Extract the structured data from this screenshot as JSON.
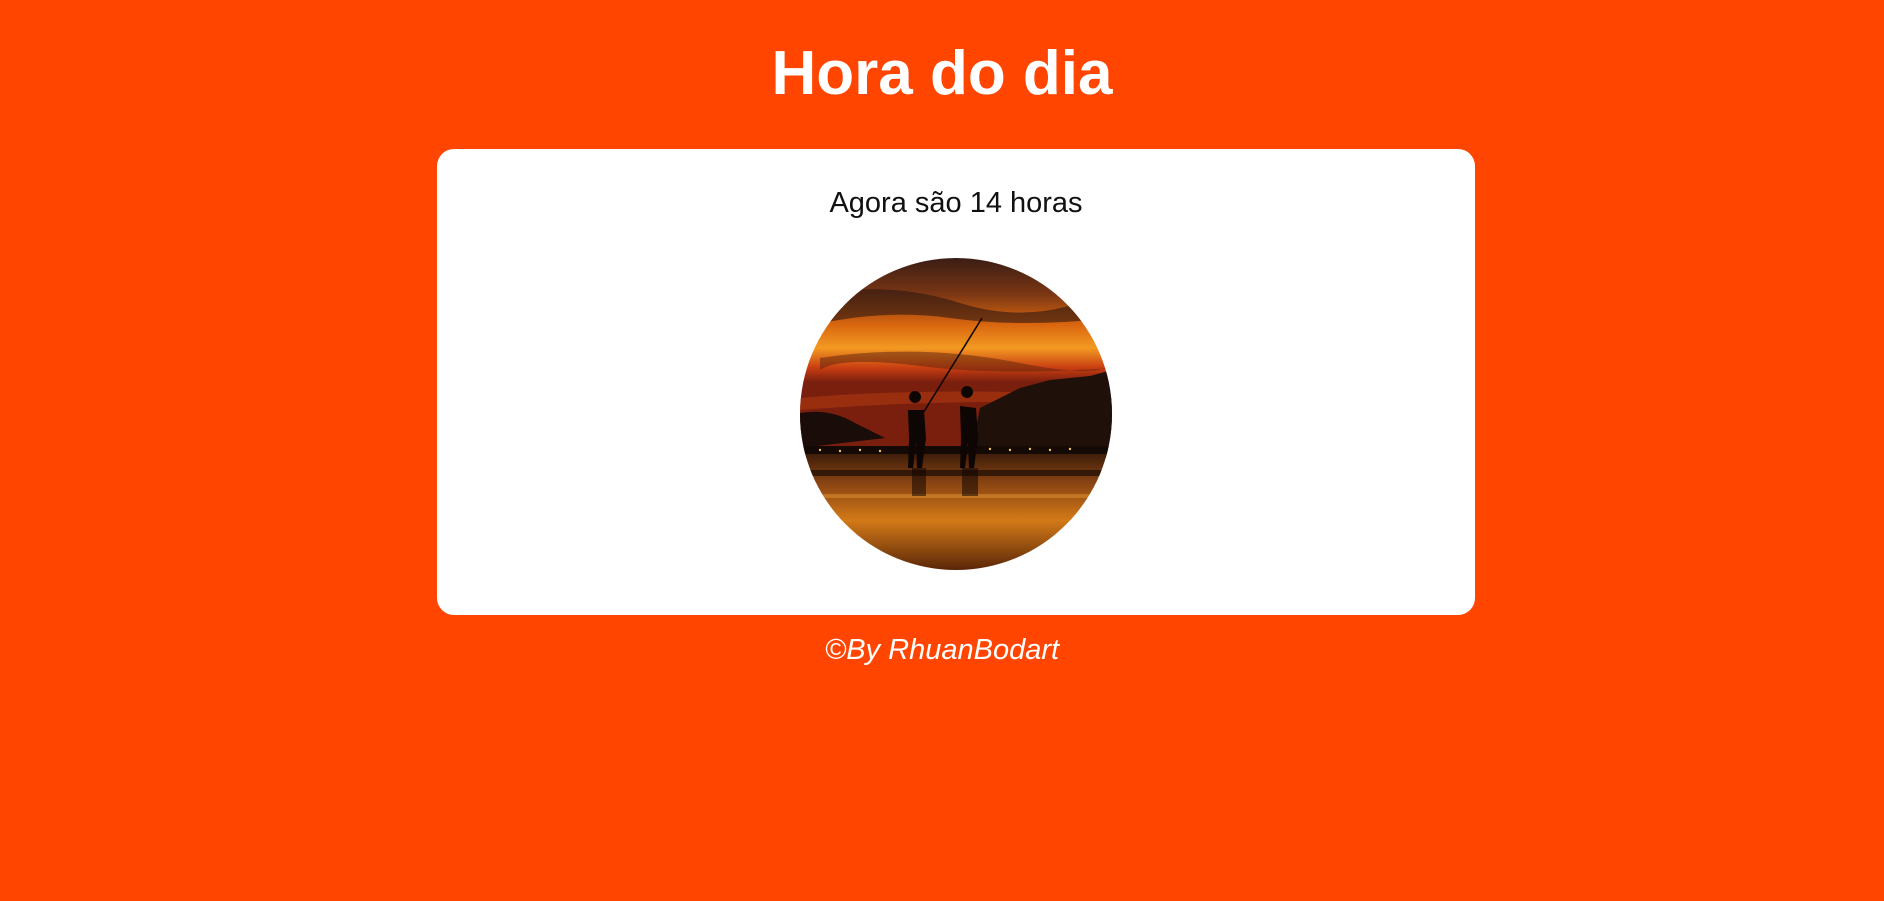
{
  "page": {
    "title": "Hora do dia",
    "background_color": "#ff4500"
  },
  "card": {
    "message": "Agora são 14 horas",
    "image": {
      "semantic": "sunset-fishermen-photo",
      "shape": "circle"
    }
  },
  "footer": {
    "text": "©By RhuanBodart"
  }
}
